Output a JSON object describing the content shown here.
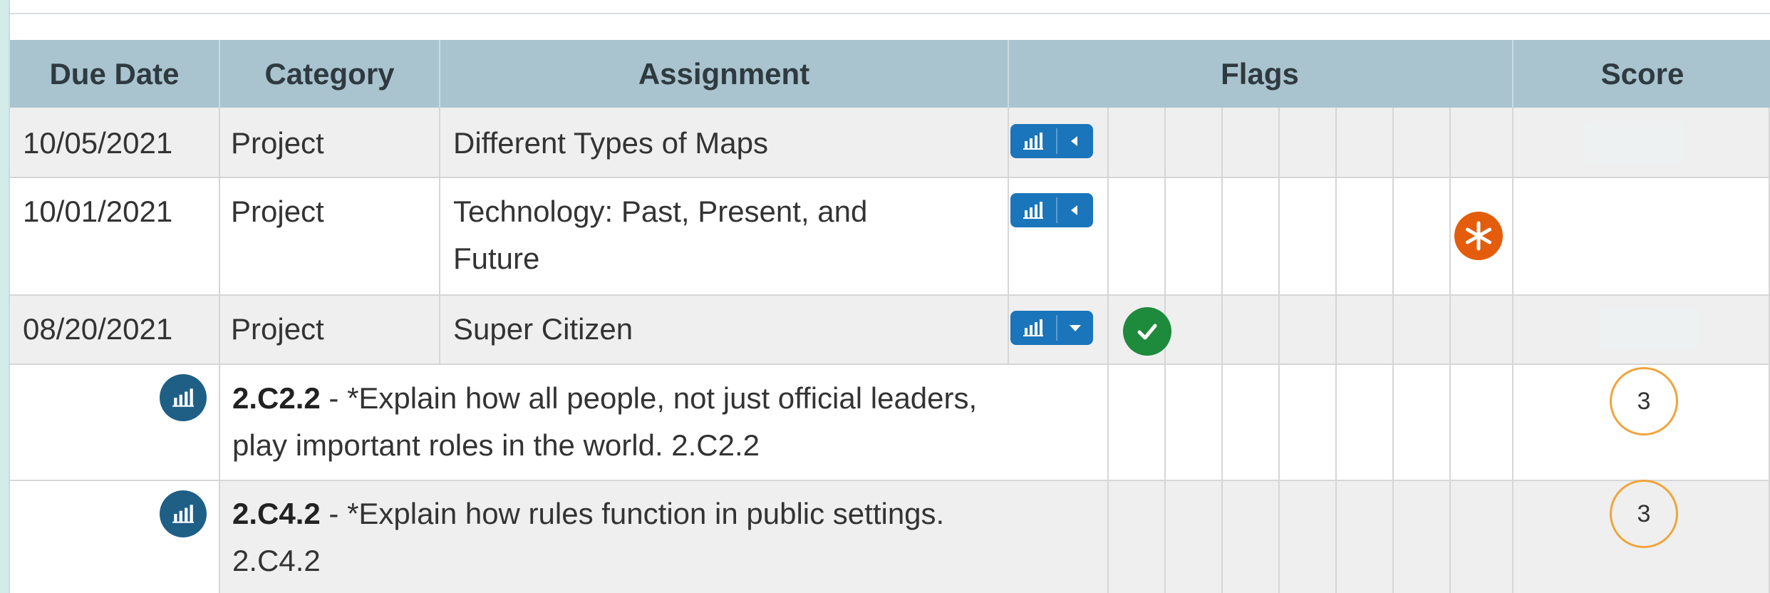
{
  "headers": {
    "due_date": "Due Date",
    "category": "Category",
    "assignment": "Assignment",
    "flags": "Flags",
    "score": "Score"
  },
  "rows": [
    {
      "due_date": "10/05/2021",
      "category": "Project",
      "assignment": "Different Types of Maps",
      "toggle": "collapsed"
    },
    {
      "due_date": "10/01/2021",
      "category": "Project",
      "assignment_line1": "Technology: Past, Present, and",
      "assignment_line2": "Future",
      "toggle": "collapsed",
      "flag": "missing"
    },
    {
      "due_date": "08/20/2021",
      "category": "Project",
      "assignment": "Super Citizen",
      "toggle": "expanded",
      "flag": "collected"
    }
  ],
  "standards": [
    {
      "code": "2.C2.2",
      "sep": " - ",
      "line1": "*Explain how all people, not just official leaders,",
      "line2": "play important roles in the world. 2.C2.2",
      "score": "3"
    },
    {
      "code": "2.C4.2",
      "sep": " - ",
      "line1": "*Explain how rules function in public settings.",
      "line2": "2.C4.2",
      "score": "3"
    }
  ],
  "icons": {
    "toggle": "bar-chart-icon",
    "collected": "check-icon",
    "missing": "asterisk-icon",
    "standard": "bar-chart-icon"
  },
  "colors": {
    "header_bg": "#a9c4cf",
    "alt_row": "#efefef",
    "button_blue": "#1b75bb",
    "check_green": "#1e8a3c",
    "missing_orange": "#e35d0c",
    "score_ring": "#f0a43a"
  }
}
